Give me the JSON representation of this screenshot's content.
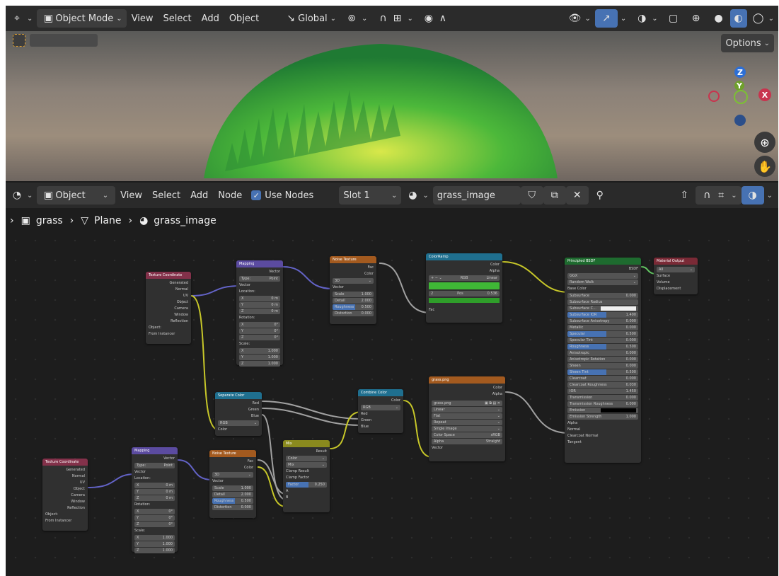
{
  "viewport_header": {
    "mode": "Object Mode",
    "menus": [
      "View",
      "Select",
      "Add",
      "Object"
    ],
    "transform": "Global",
    "options": "Options"
  },
  "node_header": {
    "editor": "Object",
    "menus": [
      "View",
      "Select",
      "Add",
      "Node"
    ],
    "use_nodes": "Use Nodes",
    "slot": "Slot 1",
    "material": "grass_image"
  },
  "breadcrumb": {
    "object": "grass",
    "mesh": "Plane",
    "material": "grass_image"
  },
  "axes": {
    "z": "Z",
    "y": "Y",
    "x": "X"
  },
  "nodes": {
    "texcoord": {
      "title": "Texture Coordinate",
      "outputs": [
        "Generated",
        "Normal",
        "UV",
        "Object",
        "Camera",
        "Window",
        "Reflection"
      ],
      "object_label": "Object:",
      "instancer": "From Instancer"
    },
    "mapping": {
      "title": "Mapping",
      "vector_out": "Vector",
      "type_label": "Type:",
      "type_value": "Point",
      "vector_in": "Vector",
      "location": "Location:",
      "rotation": "Rotation:",
      "scale": "Scale:",
      "loc": [
        [
          "X",
          "0 m"
        ],
        [
          "Y",
          "0 m"
        ],
        [
          "Z",
          "0 m"
        ]
      ],
      "rot": [
        [
          "X",
          "0°"
        ],
        [
          "Y",
          "0°"
        ],
        [
          "Z",
          "0°"
        ]
      ],
      "scl": [
        [
          "X",
          "1.000"
        ],
        [
          "Y",
          "1.000"
        ],
        [
          "Z",
          "1.000"
        ]
      ]
    },
    "noise": {
      "title": "Noise Texture",
      "outs": [
        "Fac",
        "Color"
      ],
      "dim": "3D",
      "vector": "Vector",
      "fields": [
        [
          "Scale",
          "1.000"
        ],
        [
          "Detail",
          "2.000"
        ],
        [
          "Roughness",
          "0.500"
        ],
        [
          "Distortion",
          "0.000"
        ]
      ]
    },
    "ramp": {
      "title": "ColorRamp",
      "outs": [
        "Color",
        "Alpha"
      ],
      "mode": "RGB",
      "interp": "Linear",
      "idx": "2",
      "pos_label": "Pos",
      "pos": "0.536",
      "fac": "Fac"
    },
    "bsdf": {
      "title": "Principled BSDF",
      "out": "BSDF",
      "dist": "GGX",
      "sss": "Random Walk",
      "base": "Base Color",
      "fields": [
        [
          "Subsurface",
          "0.000"
        ],
        [
          "Subsurface Radius",
          ""
        ],
        [
          "Subsurface C...",
          ""
        ],
        [
          "Subsurface IOR",
          "1.400"
        ],
        [
          "Subsurface Anisotropy",
          "0.000"
        ],
        [
          "Metallic",
          "0.000"
        ],
        [
          "Specular",
          "0.500"
        ],
        [
          "Specular Tint",
          "0.000"
        ],
        [
          "Roughness",
          "0.500"
        ],
        [
          "Anisotropic",
          "0.000"
        ],
        [
          "Anisotropic Rotation",
          "0.000"
        ],
        [
          "Sheen",
          "0.000"
        ],
        [
          "Sheen Tint",
          "0.500"
        ],
        [
          "Clearcoat",
          "0.000"
        ],
        [
          "Clearcoat Roughness",
          "0.030"
        ],
        [
          "IOR",
          "1.450"
        ],
        [
          "Transmission",
          "0.000"
        ],
        [
          "Transmission Roughness",
          "0.000"
        ],
        [
          "Emission",
          ""
        ],
        [
          "Emission Strength",
          "1.000"
        ]
      ],
      "tail": [
        "Alpha",
        "Normal",
        "Clearcoat Normal",
        "Tangent"
      ]
    },
    "output": {
      "title": "Material Output",
      "target": "All",
      "ins": [
        "Surface",
        "Volume",
        "Displacement"
      ]
    },
    "separate": {
      "title": "Separate Color",
      "outs": [
        "Red",
        "Green",
        "Blue"
      ],
      "mode": "RGB",
      "in": "Color"
    },
    "combine": {
      "title": "Combine Color",
      "out": "Color",
      "mode": "RGB",
      "ins": [
        "Red",
        "Green",
        "Blue"
      ]
    },
    "image": {
      "title": "grass.png",
      "outs": [
        "Color",
        "Alpha"
      ],
      "file": "grass.png",
      "opts": [
        "Linear",
        "Flat",
        "Repeat",
        "Single Image"
      ],
      "cs_label": "Color Space",
      "cs": "sRGB",
      "alpha_label": "Alpha",
      "alpha": "Straight",
      "vector": "Vector"
    },
    "mix": {
      "title": "Mix",
      "out": "Result",
      "type": "Color",
      "blend": "Mix",
      "clamp_result": "Clamp Result",
      "clamp_factor": "Clamp Factor",
      "factor_label": "Factor",
      "factor": "0.250",
      "a": "A",
      "b": "B"
    }
  }
}
